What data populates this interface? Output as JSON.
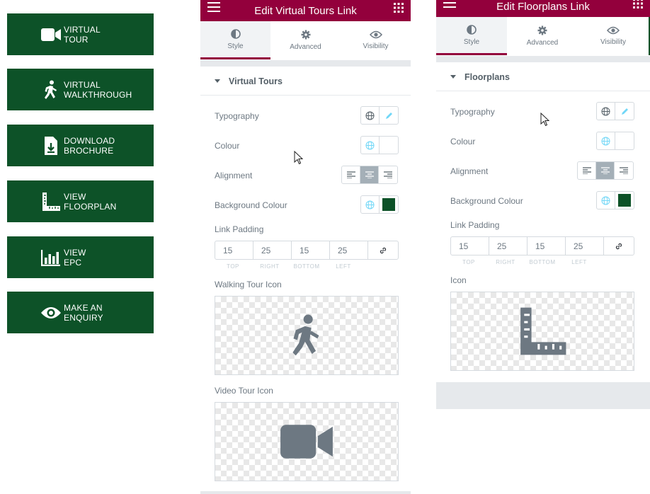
{
  "buttons": [
    {
      "line1": "VIRTUAL",
      "line2": "TOUR",
      "icon": "video-camera-icon"
    },
    {
      "line1": "VIRTUAL",
      "line2": "WALKTHROUGH",
      "icon": "walking-person-icon"
    },
    {
      "line1": "DOWNLOAD",
      "line2": "BROCHURE",
      "icon": "download-file-icon"
    },
    {
      "line1": "VIEW",
      "line2": "FLOORPLAN",
      "icon": "ruler-icon"
    },
    {
      "line1": "VIEW",
      "line2": "EPC",
      "icon": "bar-chart-icon"
    },
    {
      "line1": "MAKE AN",
      "line2": "ENQUIRY",
      "icon": "eye-icon"
    }
  ],
  "colors": {
    "button_green": "#0d5228",
    "header": "#93003c",
    "bg_swatch": "#0d5228"
  },
  "panel1": {
    "title": "Edit Virtual Tours Link",
    "tabs": [
      "Style",
      "Advanced",
      "Visibility"
    ],
    "section": "Virtual Tours",
    "typography": "Typography",
    "colour": "Colour",
    "alignment": "Alignment",
    "background": "Background Colour",
    "link_padding": "Link Padding",
    "padding": {
      "top": "15",
      "right": "25",
      "bottom": "15",
      "left": "25"
    },
    "padding_labels": [
      "TOP",
      "RIGHT",
      "BOTTOM",
      "LEFT"
    ],
    "walking_icon_label": "Walking Tour Icon",
    "video_icon_label": "Video Tour Icon"
  },
  "panel2": {
    "title": "Edit Floorplans Link",
    "tabs": [
      "Style",
      "Advanced",
      "Visibility"
    ],
    "section": "Floorplans",
    "typography": "Typography",
    "colour": "Colour",
    "alignment": "Alignment",
    "background": "Background Colour",
    "link_padding": "Link Padding",
    "padding": {
      "top": "15",
      "right": "25",
      "bottom": "15",
      "left": "25"
    },
    "padding_labels": [
      "TOP",
      "RIGHT",
      "BOTTOM",
      "LEFT"
    ],
    "icon_label": "Icon"
  }
}
